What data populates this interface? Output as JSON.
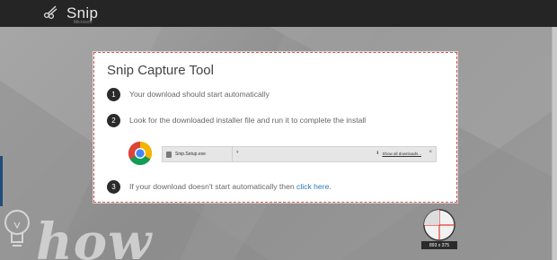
{
  "app": {
    "brand_name": "Snip",
    "brand_sub": "Microsoft"
  },
  "dialog": {
    "title": "Snip Capture Tool",
    "steps": [
      {
        "num": "1",
        "text": "Your download should start automatically"
      },
      {
        "num": "2",
        "text": "Look for the downloaded installer file and run it to complete the install"
      },
      {
        "num": "3",
        "text": "If your download doesn't start automatically then ",
        "link": "click here."
      }
    ],
    "download_bar": {
      "file_name": "Snip.Setup.exe",
      "show_all": "Show all downloads...",
      "close": "×"
    }
  },
  "background": {
    "text": "how"
  },
  "magnifier": {
    "size_label": "893 x 375"
  },
  "colors": {
    "topbar": "#252525",
    "accent_border": "#d9534f",
    "link": "#2a7ab8"
  },
  "icons": [
    "scissors-icon",
    "chrome-icon",
    "file-icon",
    "download-icon",
    "close-icon",
    "lightbulb-icon",
    "crosshair-icon"
  ]
}
